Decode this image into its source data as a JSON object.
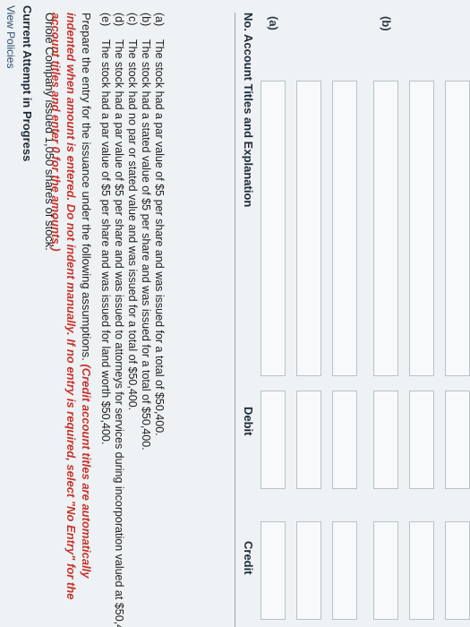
{
  "header": {
    "view_policies": "View Policies",
    "attempt_status": "Current Attempt in Progress"
  },
  "problem": {
    "intro": "Oriole Company issued 1,050 shares of stock.",
    "instructions_plain": "Prepare the entry for the issuance under the following assumptions.",
    "instructions_red": "(Credit account titles are automatically indented when amount is entered. Do not indent manually. If no entry is required, select \"No Entry\" for the account titles and enter 0 for the amounts.)",
    "assumptions": [
      {
        "letter": "(a)",
        "text": "The stock had a par value of $5 per share and was issued for a total of $50,400."
      },
      {
        "letter": "(b)",
        "text": "The stock had a stated value of $5 per share and was issued for a total of $50,400."
      },
      {
        "letter": "(c)",
        "text": "The stock had no par or stated value and was issued for a total of $50,400."
      },
      {
        "letter": "(d)",
        "text": "The stock had a par value of $5 per share and was issued to attorneys for services during incorporation valued at $50,400."
      },
      {
        "letter": "(e)",
        "text": "The stock had a par value of $5 per share and was issued for land worth $50,400."
      }
    ]
  },
  "table": {
    "col_no": "No.",
    "col_account": "Account Titles and Explanation",
    "col_debit": "Debit",
    "col_credit": "Credit",
    "rows": [
      "(a)",
      "(b)"
    ]
  },
  "colors": {
    "instruction_red": "#c8332b",
    "header_text": "#1e2a36"
  }
}
